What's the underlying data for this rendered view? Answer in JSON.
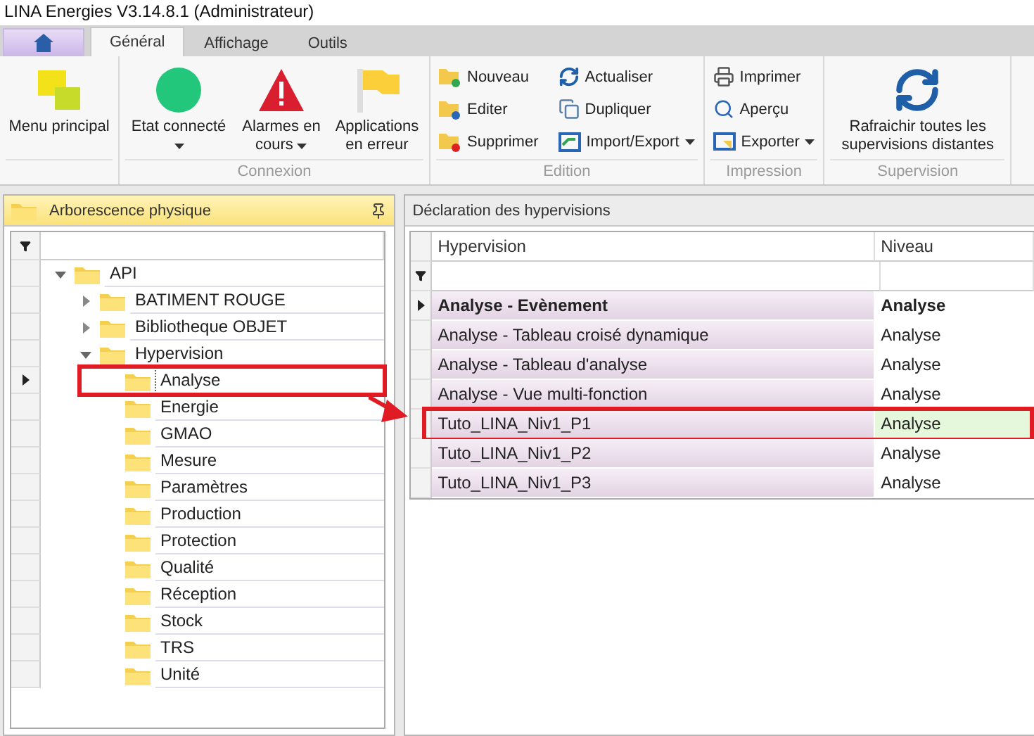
{
  "window": {
    "title": "LINA Energies  V3.14.8.1  (Administrateur)"
  },
  "tabs": [
    {
      "label": "Général",
      "selected": true
    },
    {
      "label": "Affichage",
      "selected": false
    },
    {
      "label": "Outils",
      "selected": false
    }
  ],
  "ribbon": {
    "groups": [
      {
        "items": [
          {
            "kind": "large",
            "label": "Menu principal",
            "dropdown": false
          }
        ]
      },
      {
        "label": "Connexion",
        "items": [
          {
            "kind": "large",
            "label": "Etat connecté",
            "dropdown": true
          },
          {
            "kind": "large",
            "label": "Alarmes en cours",
            "dropdown": true
          },
          {
            "kind": "large",
            "label": "Applications en erreur",
            "dropdown": false
          }
        ]
      },
      {
        "label": "Edition",
        "items": [
          {
            "kind": "small",
            "label": "Nouveau",
            "dropdown": false
          },
          {
            "kind": "small",
            "label": "Editer",
            "dropdown": false
          },
          {
            "kind": "small",
            "label": "Supprimer",
            "dropdown": false
          },
          {
            "kind": "small",
            "label": "Actualiser",
            "dropdown": false
          },
          {
            "kind": "small",
            "label": "Dupliquer",
            "dropdown": false
          },
          {
            "kind": "small",
            "label": "Import/Export",
            "dropdown": true
          }
        ]
      },
      {
        "label": "Impression",
        "items": [
          {
            "kind": "small",
            "label": "Imprimer",
            "dropdown": false
          },
          {
            "kind": "small",
            "label": "Aperçu",
            "dropdown": false
          },
          {
            "kind": "small",
            "label": "Exporter",
            "dropdown": true
          }
        ]
      },
      {
        "label": "Supervision",
        "items": [
          {
            "kind": "large",
            "label": "Rafraichir toutes les supervisions distantes",
            "dropdown": false
          }
        ]
      }
    ]
  },
  "tree_panel": {
    "title": "Arborescence physique",
    "items": [
      {
        "label": "API",
        "expanded": true,
        "selected": false,
        "highlighted": false,
        "children": [
          {
            "label": "BATIMENT ROUGE",
            "expanded": false,
            "selected": false,
            "highlighted": false
          },
          {
            "label": "Bibliotheque OBJET",
            "expanded": false,
            "selected": false,
            "highlighted": false
          },
          {
            "label": "Hypervision",
            "expanded": true,
            "selected": false,
            "highlighted": false,
            "children": [
              {
                "label": "Analyse",
                "selected": true,
                "highlighted": true
              },
              {
                "label": "Energie",
                "selected": false,
                "highlighted": false
              },
              {
                "label": "GMAO",
                "selected": false,
                "highlighted": false
              },
              {
                "label": "Mesure",
                "selected": false,
                "highlighted": false
              },
              {
                "label": "Paramètres",
                "selected": false,
                "highlighted": false
              },
              {
                "label": "Production",
                "selected": false,
                "highlighted": false
              },
              {
                "label": "Protection",
                "selected": false,
                "highlighted": false
              },
              {
                "label": "Qualité",
                "selected": false,
                "highlighted": false
              },
              {
                "label": "Réception",
                "selected": false,
                "highlighted": false
              },
              {
                "label": "Stock",
                "selected": false,
                "highlighted": false
              },
              {
                "label": "TRS",
                "selected": false,
                "highlighted": false
              },
              {
                "label": "Unité",
                "selected": false,
                "highlighted": false
              }
            ]
          }
        ]
      }
    ]
  },
  "table_panel": {
    "title": "Déclaration des hypervisions",
    "columns": [
      "Hypervision",
      "Niveau"
    ],
    "rows": [
      {
        "cells": [
          "Analyse - Evènement",
          "Analyse"
        ],
        "current": true,
        "focused": false,
        "highlighted": false
      },
      {
        "cells": [
          "Analyse - Tableau croisé dynamique",
          "Analyse"
        ],
        "current": false,
        "focused": false,
        "highlighted": false
      },
      {
        "cells": [
          "Analyse - Tableau d'analyse",
          "Analyse"
        ],
        "current": false,
        "focused": false,
        "highlighted": false
      },
      {
        "cells": [
          "Analyse - Vue multi-fonction",
          "Analyse"
        ],
        "current": false,
        "focused": false,
        "highlighted": false
      },
      {
        "cells": [
          "Tuto_LINA_Niv1_P1",
          "Analyse"
        ],
        "current": false,
        "focused": true,
        "highlighted": true
      },
      {
        "cells": [
          "Tuto_LINA_Niv1_P2",
          "Analyse"
        ],
        "current": false,
        "focused": false,
        "highlighted": false
      },
      {
        "cells": [
          "Tuto_LINA_Niv1_P3",
          "Analyse"
        ],
        "current": false,
        "focused": false,
        "highlighted": false
      }
    ]
  }
}
